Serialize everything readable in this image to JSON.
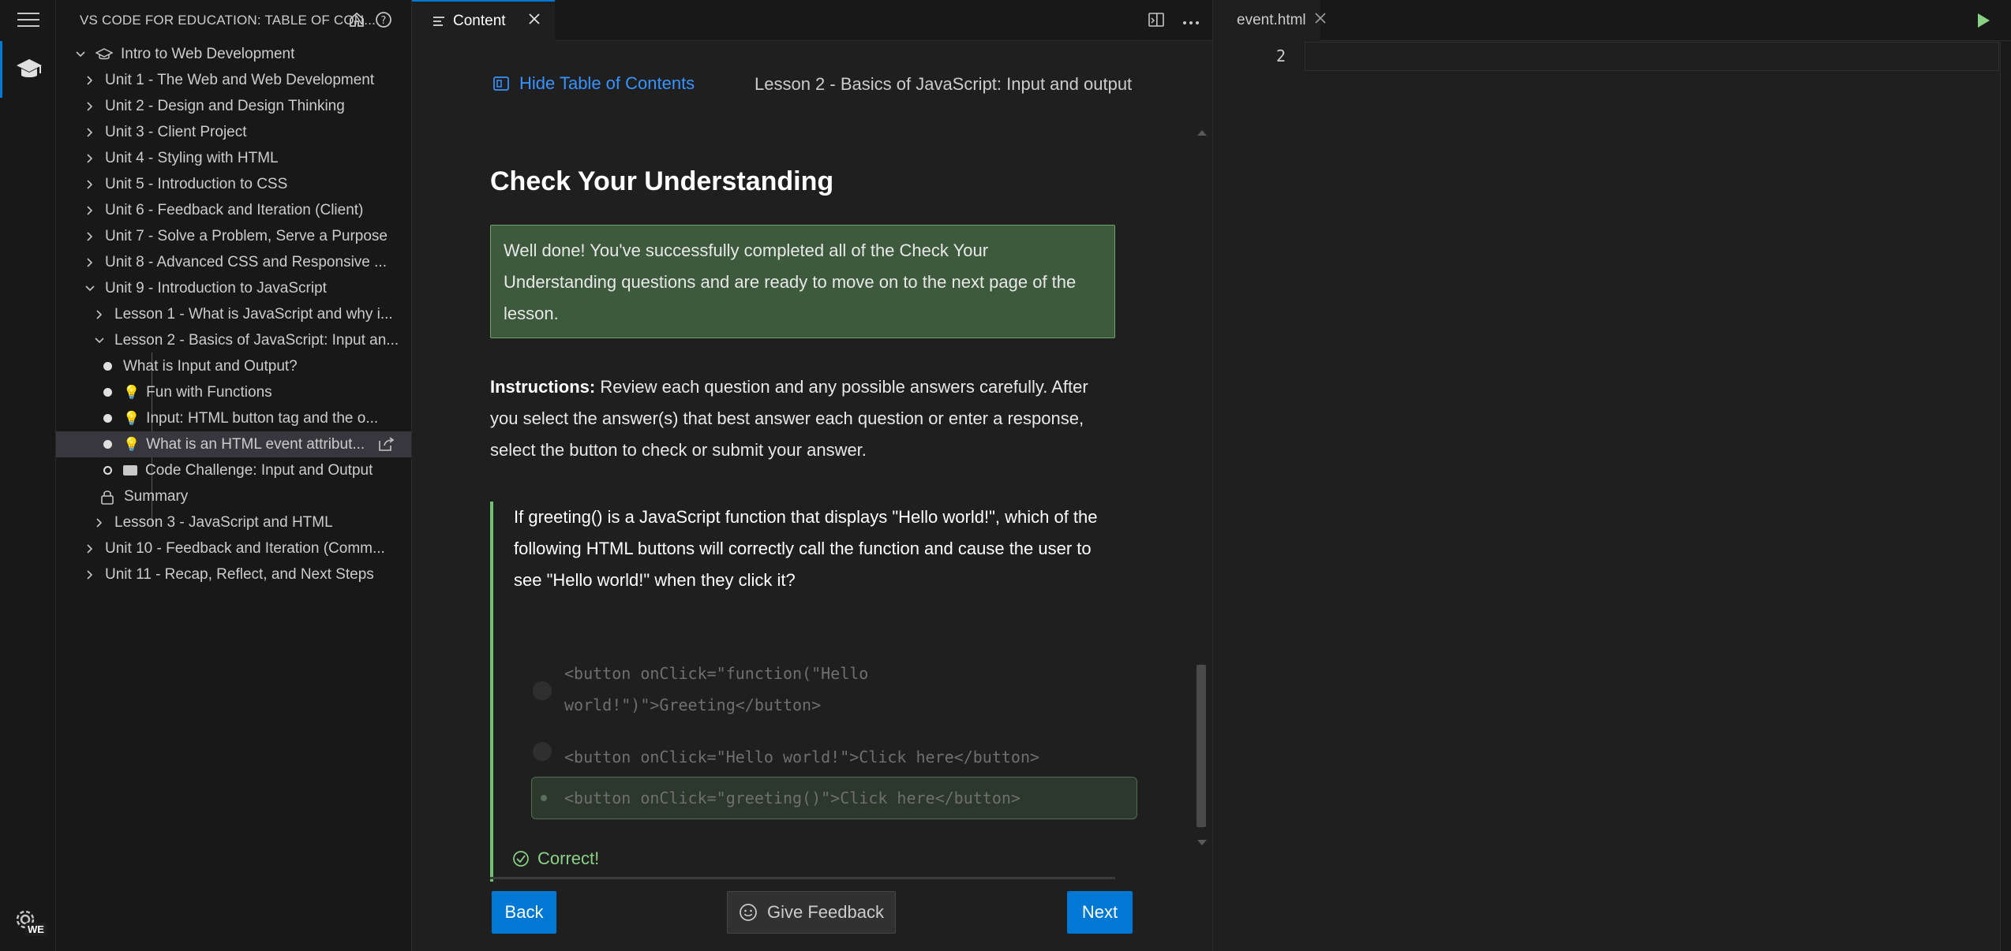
{
  "sidebar": {
    "title": "VS CODE FOR EDUCATION: TABLE OF CON...",
    "tree": [
      {
        "label": "Intro to Web Development",
        "indent": 0
      },
      {
        "label": "Unit 1 - The Web and Web Development"
      },
      {
        "label": "Unit 2 - Design and Design Thinking"
      },
      {
        "label": "Unit 3 - Client Project"
      },
      {
        "label": "Unit 4 - Styling with HTML"
      },
      {
        "label": "Unit 5 - Introduction to CSS"
      },
      {
        "label": "Unit 6 - Feedback and Iteration (Client)"
      },
      {
        "label": "Unit 7 - Solve a Problem, Serve a Purpose"
      },
      {
        "label": "Unit 8 - Advanced CSS and Responsive ..."
      },
      {
        "label": "Unit 9 - Introduction to JavaScript"
      },
      {
        "label": "Lesson 1 - What is JavaScript and why i..."
      },
      {
        "label": "Lesson 2 - Basics of JavaScript: Input an..."
      },
      {
        "label": "What is Input and Output?"
      },
      {
        "label": "Fun with Functions"
      },
      {
        "label": "Input: HTML button tag and the o..."
      },
      {
        "label": "What is an HTML event attribut..."
      },
      {
        "label": "Code Challenge: Input and Output"
      },
      {
        "label": "Summary"
      },
      {
        "label": "Lesson 3 - JavaScript and HTML"
      },
      {
        "label": "Unit 10 - Feedback and Iteration (Comm..."
      },
      {
        "label": "Unit 11 - Recap, Reflect, and Next Steps"
      }
    ]
  },
  "editor1": {
    "tab_label": "Content",
    "hide_toc": "Hide Table of Contents",
    "lesson_title": "Lesson 2 - Basics of JavaScript: Input and output",
    "heading": "Check Your Understanding",
    "success_message": "Well done! You've successfully completed all of the Check Your Understanding questions and are ready to move on to the next page of the lesson.",
    "instructions_label": "Instructions:",
    "instructions_text": " Review each question and any possible answers carefully. After you select the answer(s) that best answer each question or enter a response, select the button to check or submit your answer.",
    "question": "If greeting() is a JavaScript function that displays \"Hello world!\", which of the following HTML buttons will correctly call the function and cause the user to see \"Hello world!\" when they click it?",
    "options": [
      "<button onClick=\"function(\"Hello world!\")\">Greeting</button>",
      "<button onClick=\"Hello world!\">Click here</button>",
      "<button onClick=\"greeting()\">Click here</button>"
    ],
    "option1_line1": "<button onClick=\"function(\"Hello",
    "option1_line2": "world!\")\">Greeting</button>",
    "selected_option_index": 2,
    "result": "Correct!",
    "back": "Back",
    "feedback": "Give Feedback",
    "next": "Next"
  },
  "editor2": {
    "tab_label": "event.html",
    "line_number": "2"
  },
  "activity": {
    "badge": "WE"
  },
  "colors": {
    "accent": "#0078d4",
    "link": "#3794ff",
    "success": "#89d185",
    "success_bg": "#3d5a3d"
  }
}
